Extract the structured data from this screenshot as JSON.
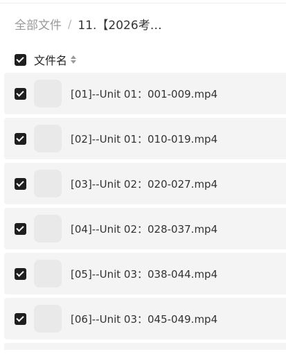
{
  "breadcrumb": {
    "root": "全部文件",
    "separator": "/",
    "current": "11.【2026考…"
  },
  "header": {
    "select_all_checked": true,
    "column_label": "文件名"
  },
  "files": [
    {
      "name": "[01]--Unit 01：001-009.mp4",
      "checked": true
    },
    {
      "name": "[02]--Unit 01：010-019.mp4",
      "checked": true
    },
    {
      "name": "[03]--Unit 02：020-027.mp4",
      "checked": true
    },
    {
      "name": "[04]--Unit 02：028-037.mp4",
      "checked": true
    },
    {
      "name": "[05]--Unit 03：038-044.mp4",
      "checked": true
    },
    {
      "name": "[06]--Unit 03：045-049.mp4",
      "checked": true
    }
  ]
}
